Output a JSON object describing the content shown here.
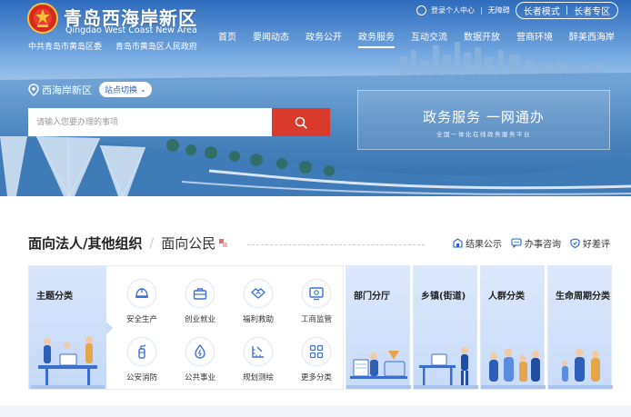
{
  "header": {
    "site_title": "青岛西海岸新区",
    "site_subtitle": "Qingdao West Coast New Area",
    "gov_links": [
      "中共青岛市黄岛区委",
      "青岛市黄岛区人民政府"
    ],
    "topbar": {
      "user_center": "登录个人中心",
      "accessibility": "无障碍",
      "elder_mode": "长者模式",
      "elder_zone": "长者专区"
    },
    "nav": [
      {
        "label": "首页",
        "active": false
      },
      {
        "label": "要闻动态",
        "active": false
      },
      {
        "label": "政务公开",
        "active": false
      },
      {
        "label": "政务服务",
        "active": true
      },
      {
        "label": "互动交流",
        "active": false
      },
      {
        "label": "数据开放",
        "active": false
      },
      {
        "label": "营商环境",
        "active": false
      },
      {
        "label": "醉美西海岸",
        "active": false
      }
    ]
  },
  "hero": {
    "location": "西海岸新区",
    "switch_label": "站点切换",
    "search_placeholder": "请输入您要办理的事项",
    "service_title": "政务服务 一网通办",
    "service_subtitle": "全国一体化在线政务服务平台"
  },
  "main": {
    "tab_active": "面向法人/其他组织",
    "tab_other": "面向公民",
    "actions": [
      {
        "label": "结果公示",
        "icon": "result-icon"
      },
      {
        "label": "办事咨询",
        "icon": "chat-icon"
      },
      {
        "label": "好差评",
        "icon": "shield-icon"
      }
    ],
    "theme_title": "主题分类",
    "categories": [
      {
        "label": "安全生产",
        "icon": "helmet-icon"
      },
      {
        "label": "创业就业",
        "icon": "briefcase-icon"
      },
      {
        "label": "福利救助",
        "icon": "handshake-icon"
      },
      {
        "label": "工商监管",
        "icon": "monitor-icon"
      },
      {
        "label": "公安消防",
        "icon": "extinguisher-icon"
      },
      {
        "label": "公共事业",
        "icon": "water-drop-icon"
      },
      {
        "label": "规划测绘",
        "icon": "ruler-icon"
      },
      {
        "label": "更多分类",
        "icon": "grid-icon"
      }
    ],
    "side_cards": [
      "部门分厅",
      "乡镇(街道)",
      "人群分类",
      "生命周期分类"
    ]
  },
  "colors": {
    "accent_red": "#d93a2b",
    "brand_blue": "#2563c8",
    "icon_blue": "#3b73d6"
  }
}
